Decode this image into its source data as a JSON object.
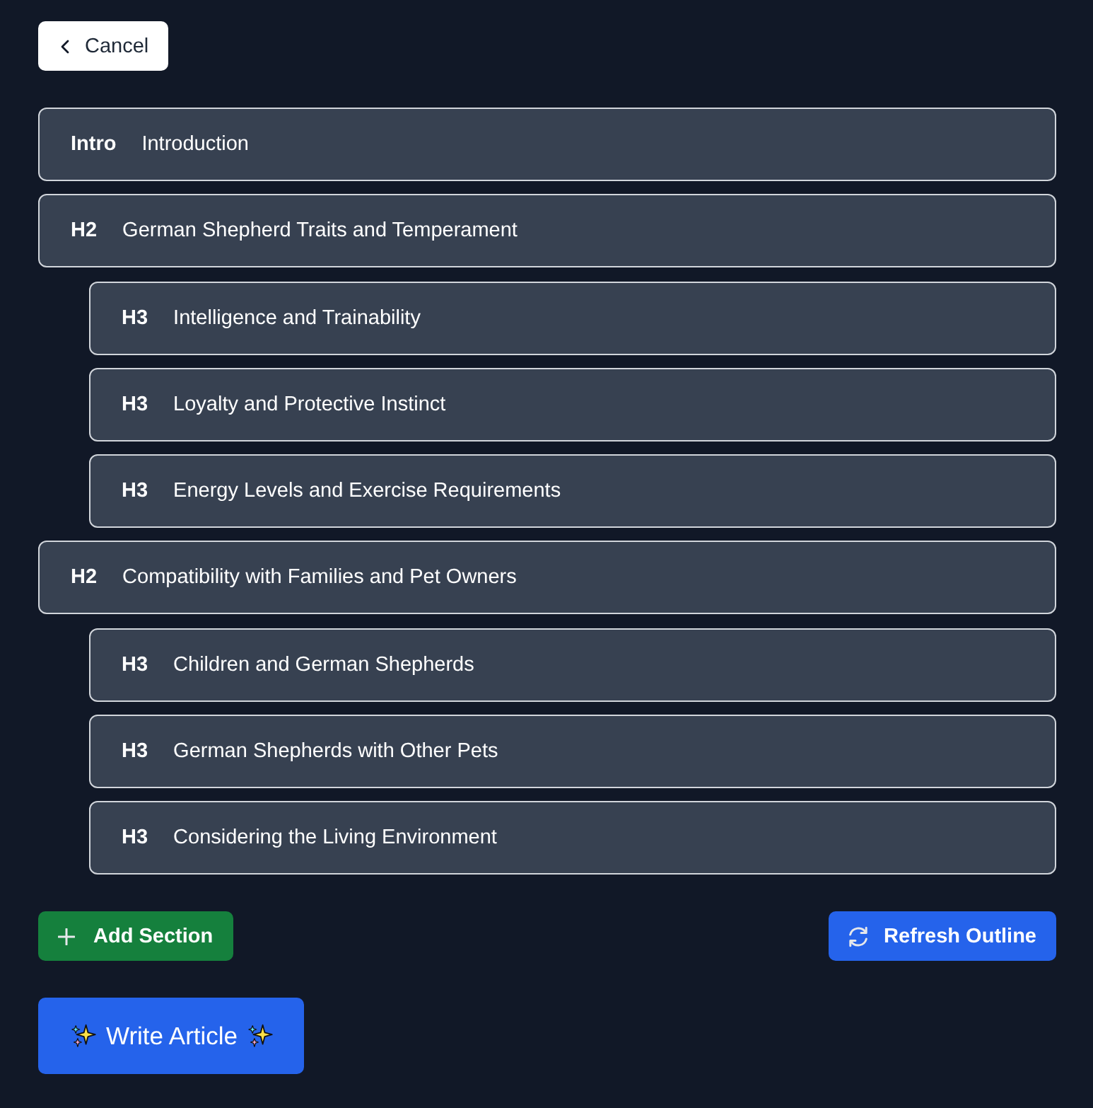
{
  "cancel_button": {
    "label": "Cancel"
  },
  "outline": [
    {
      "tag": "Intro",
      "title": "Introduction"
    },
    {
      "tag": "H2",
      "title": "German Shepherd Traits and Temperament",
      "children": [
        {
          "tag": "H3",
          "title": "Intelligence and Trainability"
        },
        {
          "tag": "H3",
          "title": "Loyalty and Protective Instinct"
        },
        {
          "tag": "H3",
          "title": "Energy Levels and Exercise Requirements"
        }
      ]
    },
    {
      "tag": "H2",
      "title": "Compatibility with Families and Pet Owners",
      "children": [
        {
          "tag": "H3",
          "title": "Children and German Shepherds"
        },
        {
          "tag": "H3",
          "title": "German Shepherds with Other Pets"
        },
        {
          "tag": "H3",
          "title": "Considering the Living Environment"
        }
      ]
    }
  ],
  "actions": [
    {
      "kind": "add",
      "label": "Add Section"
    },
    {
      "kind": "refresh",
      "label": "Refresh Outline"
    }
  ],
  "write_button": {
    "label": "Write Article"
  }
}
